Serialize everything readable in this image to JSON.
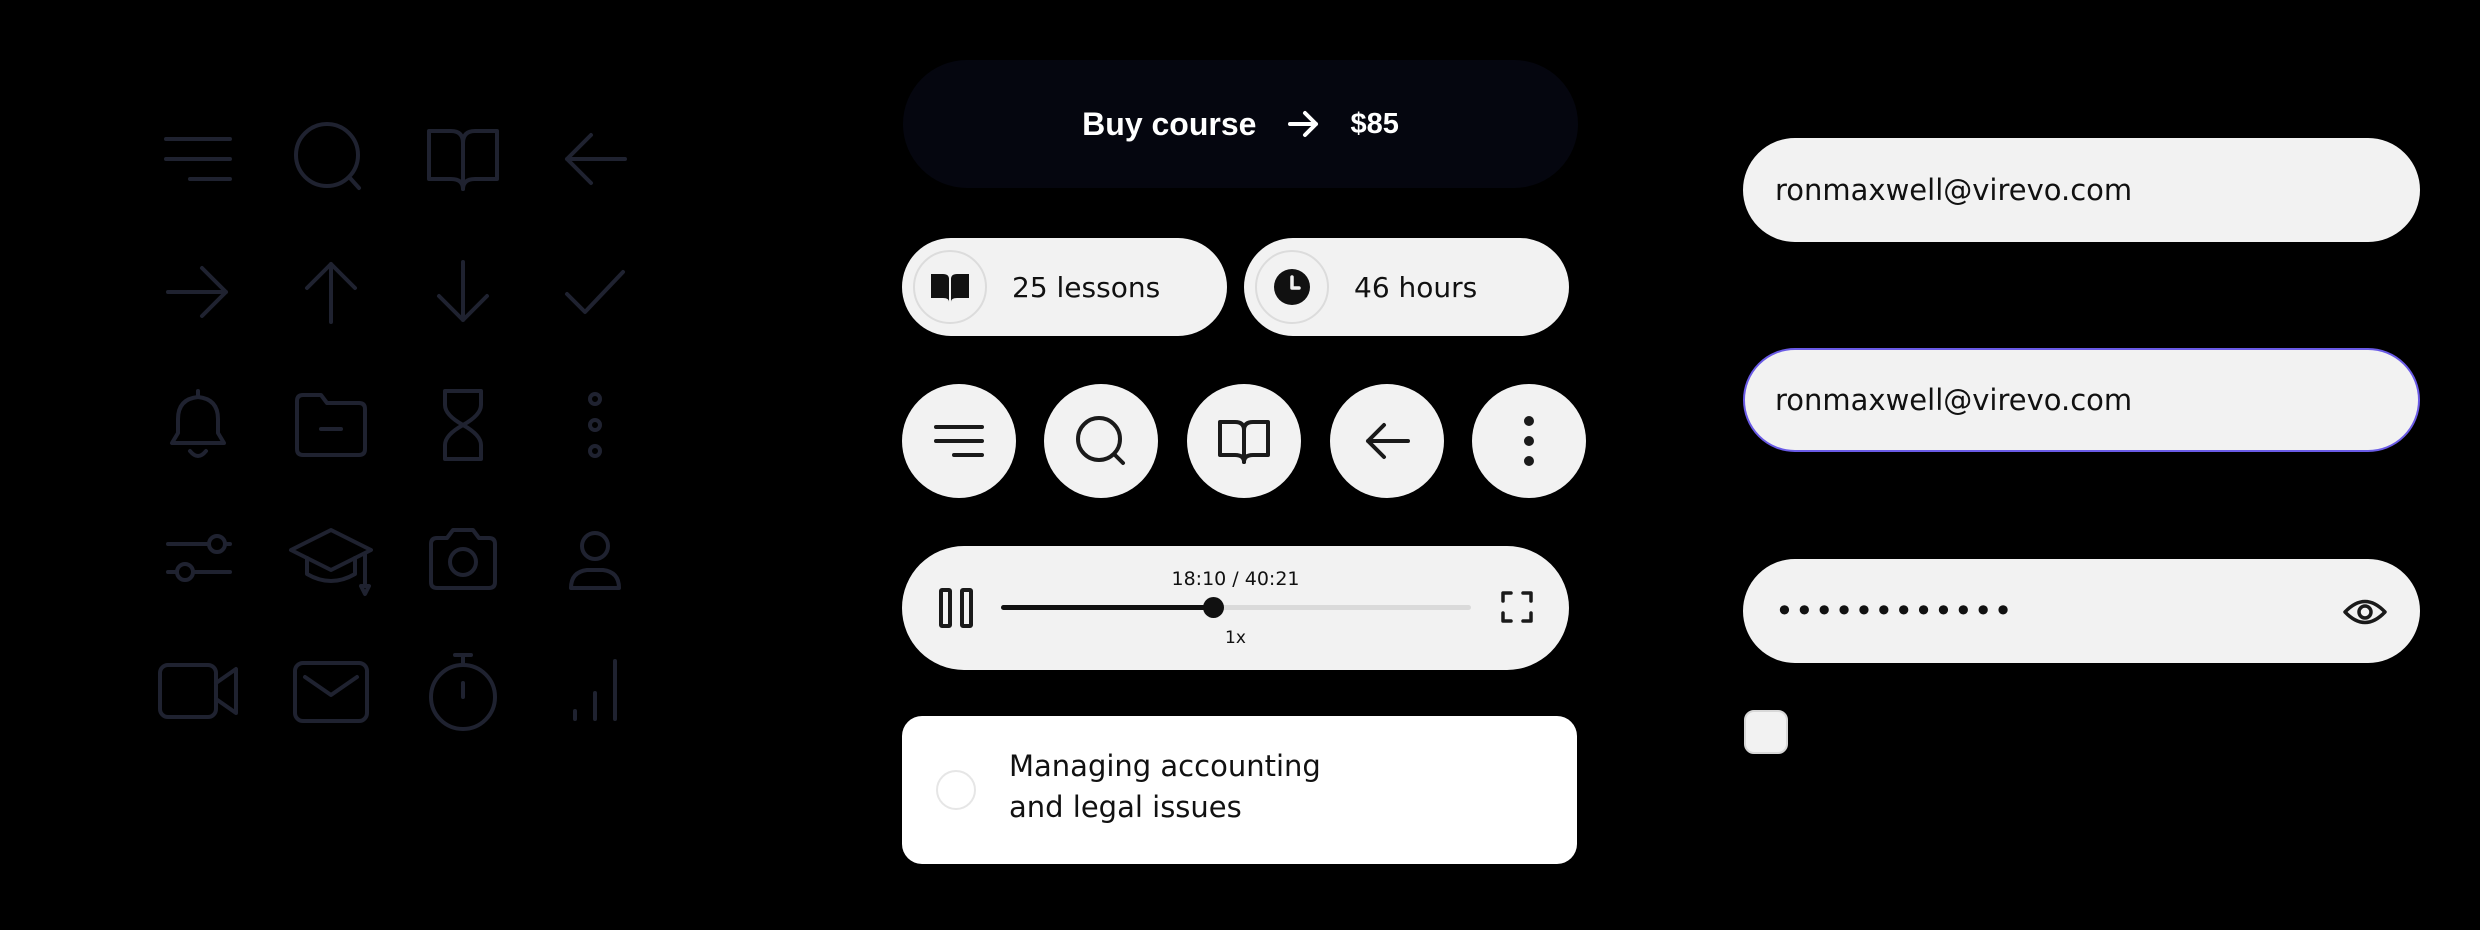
{
  "icon_grid": {
    "icons": [
      "menu-icon",
      "search-icon",
      "book-icon",
      "arrow-left-icon",
      "arrow-right-icon",
      "arrow-up-icon",
      "arrow-down-icon",
      "check-icon",
      "bell-icon",
      "folder-minus-icon",
      "hourglass-icon",
      "more-vertical-icon",
      "sliders-icon",
      "graduation-cap-icon",
      "camera-icon",
      "user-icon",
      "video-icon",
      "mail-icon",
      "stopwatch-icon",
      "bar-chart-icon"
    ],
    "stroke_color": "#1f2230"
  },
  "buy_button": {
    "label": "Buy course",
    "price": "$85",
    "icon": "arrow-right-icon",
    "background": "#05060f"
  },
  "stats": [
    {
      "icon": "book-icon",
      "label": "25 lessons"
    },
    {
      "icon": "clock-icon",
      "label": "46 hours"
    }
  ],
  "round_buttons": [
    "menu-icon",
    "search-icon",
    "book-icon",
    "arrow-left-icon",
    "more-vertical-icon"
  ],
  "player": {
    "time": "18:10 / 40:21",
    "speed": "1x",
    "progress": 0.45,
    "pause_icon": "pause-icon",
    "fullscreen_icon": "fullscreen-icon"
  },
  "task": {
    "line1": "Managing accounting",
    "line2": "and legal issues",
    "checked": false
  },
  "form": {
    "email_value": "ronmaxwell@virevo.com",
    "email_focused_value": "ronmaxwell@virevo.com",
    "password_value": "••••••••••••",
    "focus_color": "#6a5be6",
    "eye_icon": "eye-icon",
    "checkbox_checked": false
  }
}
